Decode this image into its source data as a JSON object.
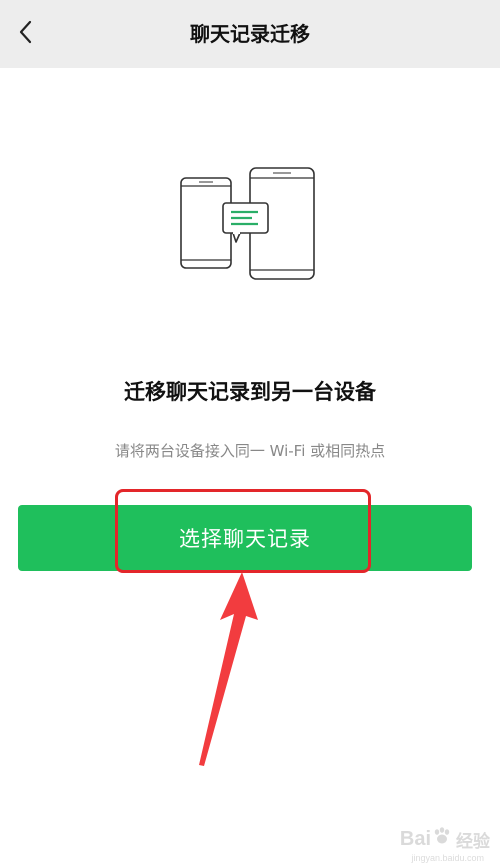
{
  "header": {
    "title": "聊天记录迁移",
    "back_icon": "chevron-left-icon"
  },
  "illustration": {
    "icon": "two-phones-transfer-icon",
    "accent_color": "#2aae67"
  },
  "main": {
    "heading": "迁移聊天记录到另一台设备",
    "subtext": "请将两台设备接入同一 Wi-Fi 或相同热点",
    "primary_button_label": "选择聊天记录"
  },
  "annotation": {
    "highlight_color": "#e3262a"
  },
  "watermark": {
    "brand_left": "Bai",
    "brand_right": "经验",
    "url": "jingyan.baidu.com"
  },
  "colors": {
    "header_bg": "#ededed",
    "button_green": "#1fbf5c"
  }
}
